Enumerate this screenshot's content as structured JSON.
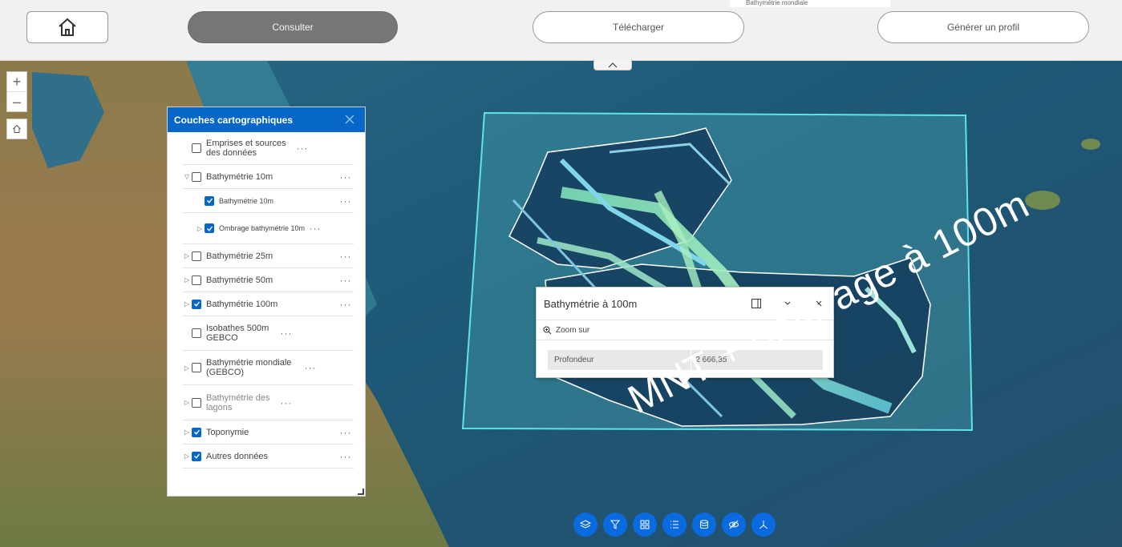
{
  "topbar": {
    "buttons": {
      "consulter": "Consulter",
      "telecharger": "Télécharger",
      "profil": "Générer un profil"
    },
    "legend_peek": "Bathymétrie mondiale"
  },
  "zoom": {
    "in": "+",
    "out": "–"
  },
  "layers_panel": {
    "title": "Couches cartographiques",
    "rows": [
      {
        "label": "Emprises et sources des données",
        "checked": false,
        "expandable": false,
        "indent": 0
      },
      {
        "label": "Bathymétrie 10m",
        "checked": false,
        "expandable": true,
        "expanded": true,
        "indent": 0
      },
      {
        "label": "Bathymétrie 10m",
        "checked": true,
        "expandable": false,
        "indent": 1
      },
      {
        "label": "Ombrage bathymétrie 10m",
        "checked": true,
        "expandable": true,
        "indent": 1
      },
      {
        "label": "Bathymétrie 25m",
        "checked": false,
        "expandable": true,
        "indent": 0
      },
      {
        "label": "Bathymétrie 50m",
        "checked": false,
        "expandable": true,
        "indent": 0
      },
      {
        "label": "Bathymétrie 100m",
        "checked": true,
        "expandable": true,
        "indent": 0
      },
      {
        "label": "Isobathes 500m GEBCO",
        "checked": false,
        "expandable": false,
        "indent": 0
      },
      {
        "label": "Bathymétrie mondiale (GEBCO)",
        "checked": false,
        "expandable": true,
        "indent": 0
      },
      {
        "label": "Bathymétrie des lagons",
        "checked": false,
        "expandable": true,
        "indent": 0,
        "greyed": true
      },
      {
        "label": "Toponymie",
        "checked": true,
        "expandable": true,
        "indent": 0
      },
      {
        "label": "Autres données",
        "checked": true,
        "expandable": true,
        "indent": 0
      }
    ]
  },
  "popup": {
    "title": "Bathymétrie à 100m",
    "zoom_label": "Zoom sur",
    "attr_key": "Profondeur",
    "attr_value": "-2 666,35"
  },
  "overlay_text": "MNT + ombrage à 100m",
  "colors": {
    "accent": "#0767c9",
    "tool_button": "#0a6be0",
    "footprint_outline": "#5fe3e6"
  }
}
